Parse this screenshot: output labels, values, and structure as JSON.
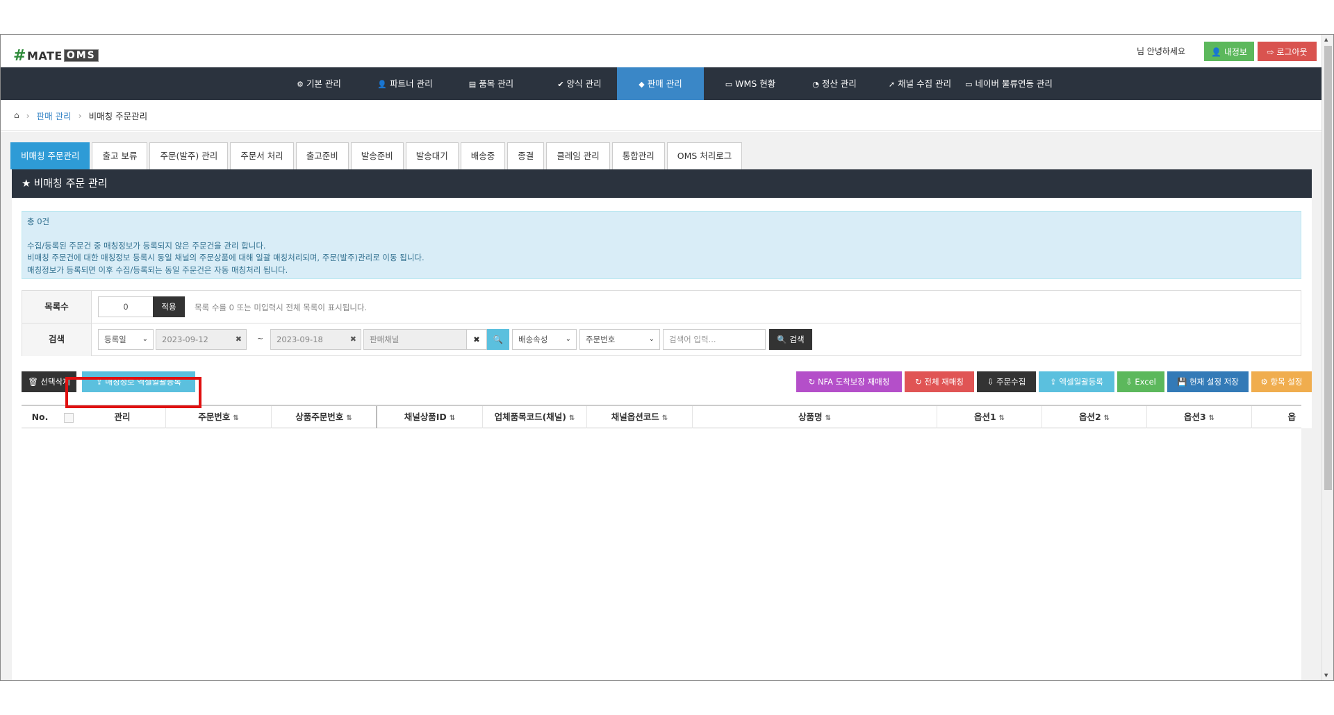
{
  "header": {
    "logo_text": "MATE",
    "logo_suffix": "OMS",
    "greeting": "님 안녕하세요",
    "myinfo_label": "내정보",
    "logout_label": "로그아웃",
    "colors": {
      "myinfo": "#5cb85c",
      "logout": "#d9534f"
    }
  },
  "nav": {
    "items": [
      {
        "label": "기본 관리",
        "icon": "gear-icon"
      },
      {
        "label": "파트너 관리",
        "icon": "user-icon"
      },
      {
        "label": "품목 관리",
        "icon": "list-icon"
      },
      {
        "label": "양식 관리",
        "icon": "check-icon"
      },
      {
        "label": "판매 관리",
        "icon": "diamond-icon",
        "active": true
      },
      {
        "label": "WMS 현황",
        "icon": "card-icon"
      },
      {
        "label": "정산 관리",
        "icon": "pie-icon"
      },
      {
        "label": "채널 수집 관리",
        "icon": "rss-icon"
      },
      {
        "label": "네이버 물류연동 관리",
        "icon": "card-icon"
      }
    ],
    "active_color": "#3a87c7"
  },
  "breadcrumb": {
    "level1": "판매 관리",
    "level2": "비매칭 주문관리"
  },
  "tabs": [
    {
      "label": "비매칭 주문관리",
      "active": true
    },
    {
      "label": "출고 보류"
    },
    {
      "label": "주문(발주) 관리"
    },
    {
      "label": "주문서 처리"
    },
    {
      "label": "출고준비"
    },
    {
      "label": "발송준비"
    },
    {
      "label": "발송대기"
    },
    {
      "label": "배송중"
    },
    {
      "label": "종결"
    },
    {
      "label": "클레임 관리"
    },
    {
      "label": "통합관리"
    },
    {
      "label": "OMS 처리로그"
    }
  ],
  "panel": {
    "title": "비매칭 주문 관리",
    "info": {
      "count": "총 0건",
      "line1": "수집/등록된 주문건 중 매칭정보가 등록되지 않은 주문건을 관리 합니다.",
      "line2": "비매칭 주문건에 대한 매칭정보 등록시 동일 채널의 주문상품에 대해 일괄 매칭처리되며, 주문(발주)관리로 이동 됩니다.",
      "line3": "매칭정보가 등록되면 이후 수집/등록되는 동일 주문건은 자동 매칭처리 됩니다."
    }
  },
  "filters": {
    "list_count_label": "목록수",
    "list_count_value": "0",
    "apply_label": "적용",
    "list_hint": "목록 수를 0 또는 미입력시 전체 목록이 표시됩니다.",
    "search_label": "검색",
    "date_type": "등록일",
    "date_from": "2023-09-12",
    "date_to": "2023-09-18",
    "tilde": "~",
    "channel_placeholder": "판매채널",
    "shipping_attr": "배송속성",
    "order_no": "주문번호",
    "keyword_placeholder": "검색어 입력...",
    "search_btn": "검색"
  },
  "toolbar": {
    "delete_selected": "선택삭제",
    "matching_excel": "매칭정보 엑셀일괄등록",
    "nfa_rematch": "NFA 도착보장 재매칭",
    "all_rematch": "전체 재매칭",
    "order_collect": "주문수집",
    "excel_bulk": "엑셀일괄등록",
    "excel": "Excel",
    "save_settings": "현재 설정 저장",
    "item_settings": "항목 설정",
    "colors": {
      "dark": "#333333",
      "info": "#5bc0de",
      "purple": "#b44fc9",
      "red": "#e05454",
      "green": "#5cb85c",
      "blue": "#337ab7",
      "orange": "#f0ad4e"
    }
  },
  "table": {
    "columns": [
      "No.",
      "",
      "관리",
      "주문번호",
      "상품주문번호",
      "채널상품ID",
      "업체품목코드(채널)",
      "채널옵션코드",
      "상품명",
      "옵션1",
      "옵션2",
      "옵션3",
      "옵"
    ]
  }
}
